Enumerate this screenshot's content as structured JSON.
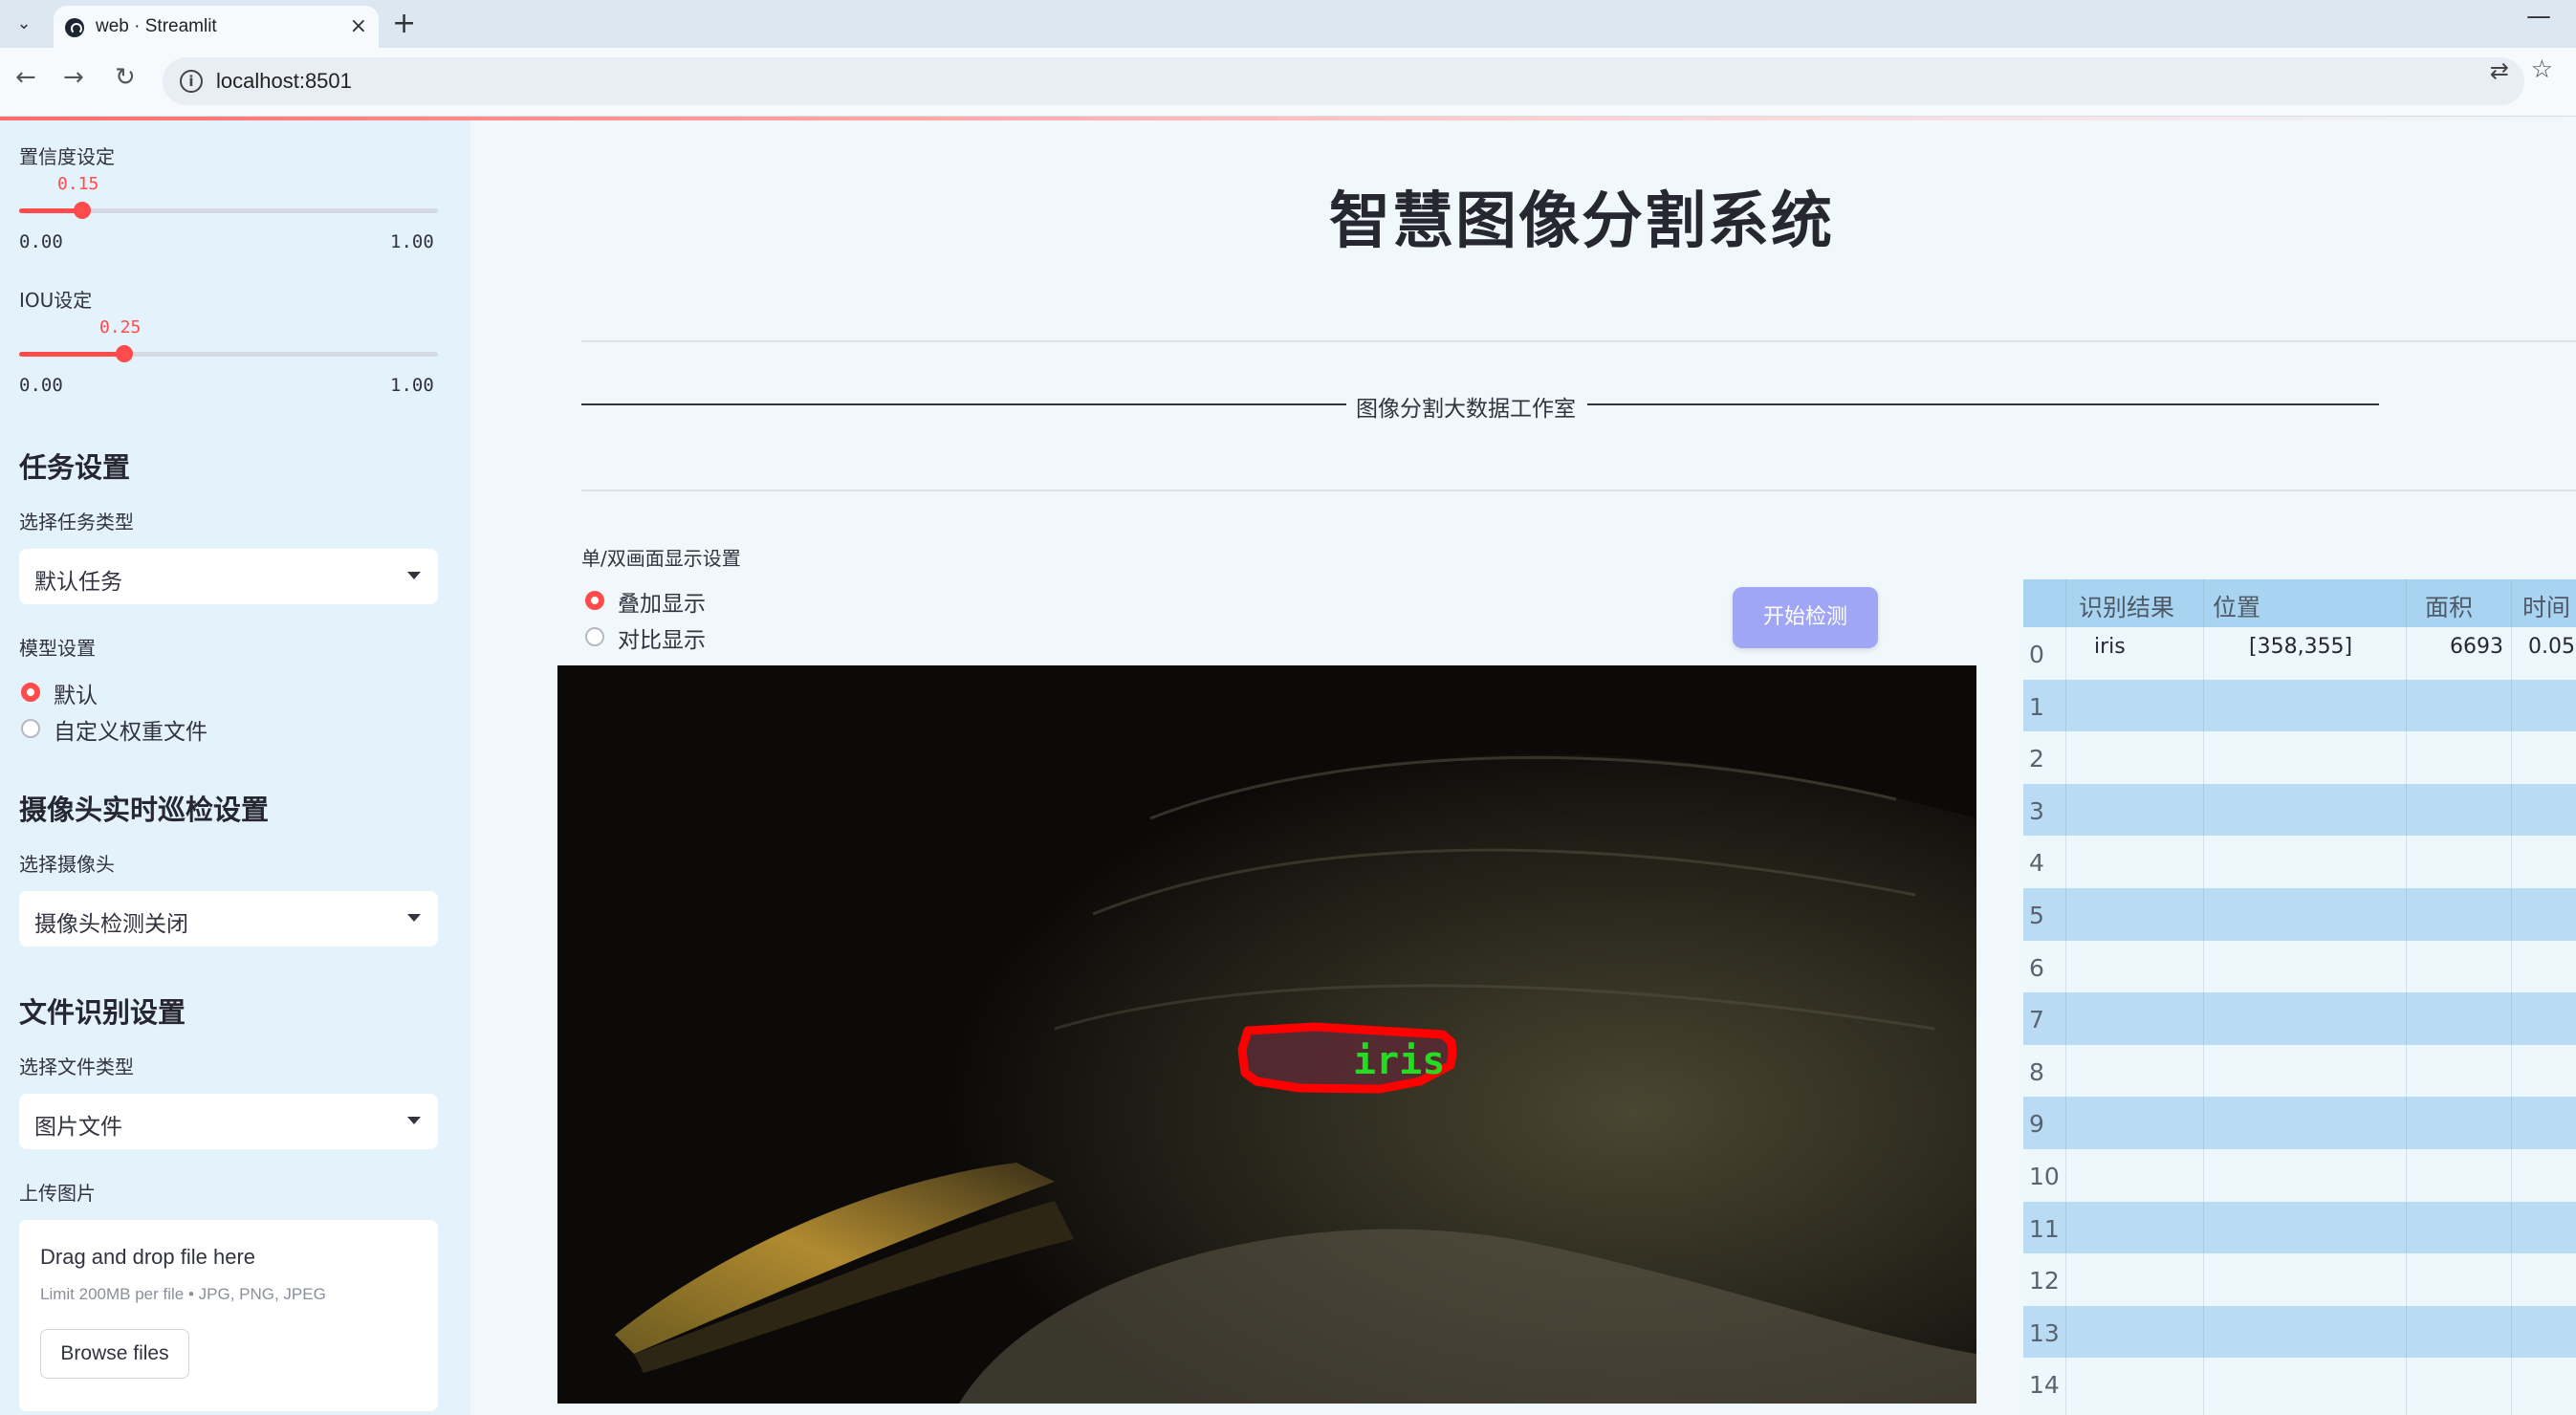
{
  "browser": {
    "tab_title": "web · Streamlit",
    "url": "localhost:8501",
    "tab_close": "×",
    "new_tab": "+",
    "minimize": "—"
  },
  "sidebar": {
    "confidence": {
      "label": "置信度设定",
      "value": "0.15",
      "value_num": 0.15,
      "min": "0.00",
      "max": "1.00"
    },
    "iou": {
      "label": "IOU设定",
      "value": "0.25",
      "value_num": 0.25,
      "min": "0.00",
      "max": "1.00"
    },
    "task_section": "任务设置",
    "task_type_label": "选择任务类型",
    "task_type_value": "默认任务",
    "model_label": "模型设置",
    "model_options": [
      "默认",
      "自定义权重文件"
    ],
    "model_selected": 0,
    "camera_section": "摄像头实时巡检设置",
    "camera_label": "选择摄像头",
    "camera_value": "摄像头检测关闭",
    "file_section": "文件识别设置",
    "file_type_label": "选择文件类型",
    "file_type_value": "图片文件",
    "upload_label": "上传图片",
    "upload_title": "Drag and drop file here",
    "upload_limit": "Limit 200MB per file • JPG, PNG, JPEG",
    "browse_button": "Browse files"
  },
  "main": {
    "title": "智慧图像分割系统",
    "studio_text": "图像分割大数据工作室",
    "display_label": "单/双画面显示设置",
    "display_options": [
      "叠加显示",
      "对比显示"
    ],
    "display_selected": 0,
    "start_button": "开始检测",
    "detection_label": "iris"
  },
  "table": {
    "headers": [
      "识别结果",
      "位置",
      "面积",
      "时间"
    ],
    "rows": [
      {
        "index": "0",
        "result": "iris",
        "position": "[358,355]",
        "area": "6693",
        "time": "0.05"
      },
      {
        "index": "1",
        "result": "",
        "position": "",
        "area": "",
        "time": ""
      },
      {
        "index": "2",
        "result": "",
        "position": "",
        "area": "",
        "time": ""
      },
      {
        "index": "3",
        "result": "",
        "position": "",
        "area": "",
        "time": ""
      },
      {
        "index": "4",
        "result": "",
        "position": "",
        "area": "",
        "time": ""
      },
      {
        "index": "5",
        "result": "",
        "position": "",
        "area": "",
        "time": ""
      },
      {
        "index": "6",
        "result": "",
        "position": "",
        "area": "",
        "time": ""
      },
      {
        "index": "7",
        "result": "",
        "position": "",
        "area": "",
        "time": ""
      },
      {
        "index": "8",
        "result": "",
        "position": "",
        "area": "",
        "time": ""
      },
      {
        "index": "9",
        "result": "",
        "position": "",
        "area": "",
        "time": ""
      },
      {
        "index": "10",
        "result": "",
        "position": "",
        "area": "",
        "time": ""
      },
      {
        "index": "11",
        "result": "",
        "position": "",
        "area": "",
        "time": ""
      },
      {
        "index": "12",
        "result": "",
        "position": "",
        "area": "",
        "time": ""
      },
      {
        "index": "13",
        "result": "",
        "position": "",
        "area": "",
        "time": ""
      },
      {
        "index": "14",
        "result": "",
        "position": "",
        "area": "",
        "time": ""
      }
    ]
  },
  "colors": {
    "accent": "#ff4b4b",
    "sidebar_bg": "#e4f2fb",
    "button": "#a0a6f6",
    "mask_outline": "#ff0000",
    "label_green": "#22dd22"
  }
}
